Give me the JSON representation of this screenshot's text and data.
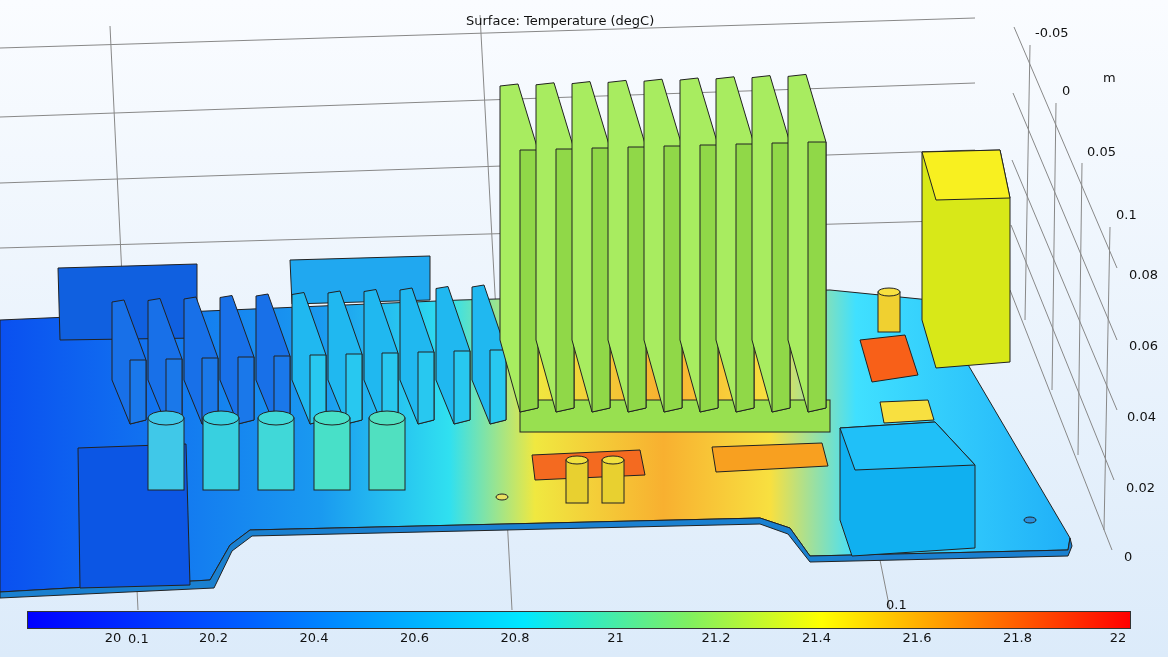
{
  "title": "Surface: Temperature (degC)",
  "unit": "m",
  "y_axis_ticks": [
    "-0.05",
    "0",
    "0.05",
    "0.1"
  ],
  "z_axis_ticks": [
    "0.08",
    "0.06",
    "0.04",
    "0.02",
    "0"
  ],
  "x_axis_ticks": [
    "0.1",
    "0.1"
  ],
  "colorbar": {
    "ticks": [
      "20",
      "20.2",
      "20.4",
      "20.6",
      "20.8",
      "21",
      "21.2",
      "21.4",
      "21.6",
      "21.8",
      "22"
    ]
  }
}
